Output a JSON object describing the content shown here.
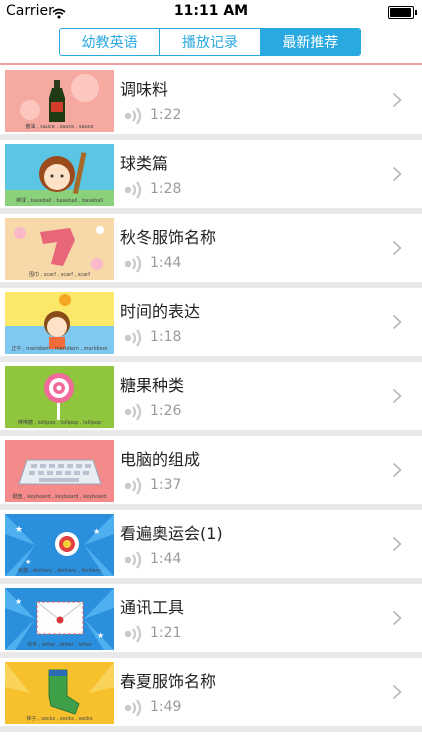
{
  "status": {
    "carrier": "Carrier",
    "time": "11:11 AM",
    "battery_level": 0.95
  },
  "tabs": [
    {
      "label": "幼教英语",
      "active": false
    },
    {
      "label": "播放记录",
      "active": false
    },
    {
      "label": "最新推荐",
      "active": true
    }
  ],
  "colors": {
    "accent": "#2aa9e0",
    "divider": "#f1a0a0"
  },
  "items": [
    {
      "title": "调味料",
      "duration": "1:22",
      "caption": "酱油 , sauce , sauce , sauce"
    },
    {
      "title": "球类篇",
      "duration": "1:28",
      "caption": "棒球 , baseball , baseball , baseball"
    },
    {
      "title": "秋冬服饰名称",
      "duration": "1:44",
      "caption": "围巾 , scarf , scarf , scarf"
    },
    {
      "title": "时间的表达",
      "duration": "1:18",
      "caption": "正午 , meridiem , meridiem , meridiem"
    },
    {
      "title": "糖果种类",
      "duration": "1:26",
      "caption": "棒棒糖 , lollipop , lollipop , lollipop"
    },
    {
      "title": "电脑的组成",
      "duration": "1:37",
      "caption": "键盘 , keyboard , keyboard , keyboard"
    },
    {
      "title": "看遍奥运会(1)",
      "duration": "1:44",
      "caption": "射箭 , Archery , Archery , Archery"
    },
    {
      "title": "通讯工具",
      "duration": "1:21",
      "caption": "信件 , letter , letter , letter"
    },
    {
      "title": "春夏服饰名称",
      "duration": "1:49",
      "caption": "袜子 , socks , socks , socks"
    }
  ]
}
